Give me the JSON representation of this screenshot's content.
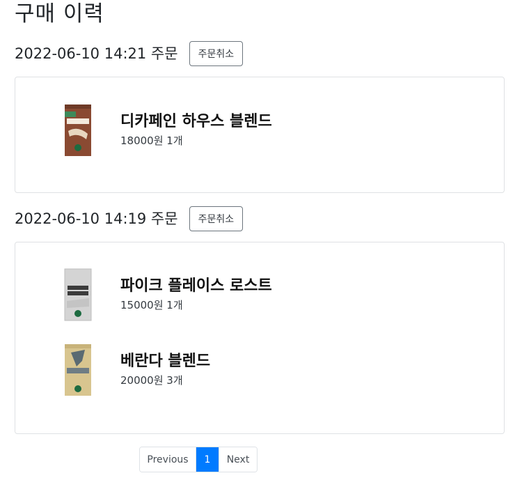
{
  "page": {
    "title": "구매 이력"
  },
  "orders": [
    {
      "date_label": "2022-06-10 14:21 주문",
      "cancel_label": "주문취소",
      "items": [
        {
          "name": "디카페인 하우스 블렌드",
          "meta": "18000원 1개",
          "image_icon": "decaf-house-blend-bag"
        }
      ]
    },
    {
      "date_label": "2022-06-10 14:19 주문",
      "cancel_label": "주문취소",
      "items": [
        {
          "name": "파이크 플레이스 로스트",
          "meta": "15000원 1개",
          "image_icon": "pike-place-roast-bag"
        },
        {
          "name": "베란다 블렌드",
          "meta": "20000원 3개",
          "image_icon": "veranda-blend-bag"
        }
      ]
    }
  ],
  "pagination": {
    "previous": "Previous",
    "current": "1",
    "next": "Next"
  },
  "colors": {
    "accent": "#007bff",
    "card_border": "#dfe1e4"
  }
}
